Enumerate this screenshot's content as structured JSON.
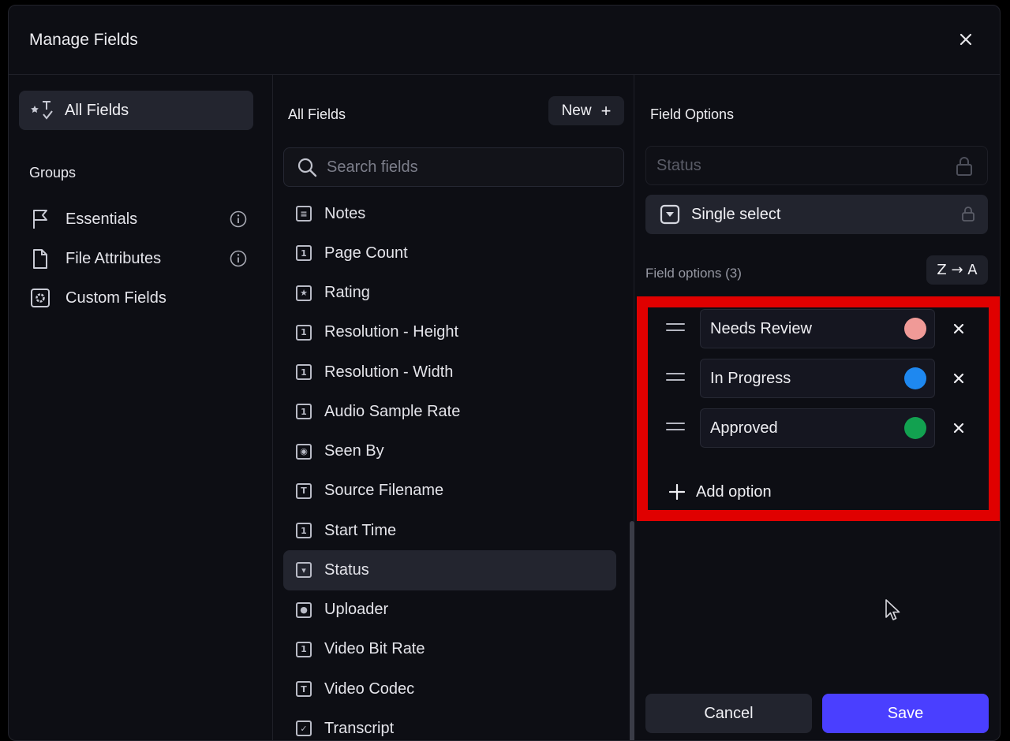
{
  "modal": {
    "title": "Manage Fields",
    "close_icon": "close-icon"
  },
  "left": {
    "all_fields_label": "All Fields",
    "groups_heading": "Groups",
    "groups": [
      {
        "label": "Essentials",
        "icon": "flag-icon"
      },
      {
        "label": "File Attributes",
        "icon": "file-icon"
      },
      {
        "label": "Custom Fields",
        "icon": "gear-box-icon"
      }
    ]
  },
  "middle": {
    "title": "All Fields",
    "new_label": "New",
    "search_placeholder": "Search fields",
    "fields": [
      {
        "label": "Notes",
        "glyph": "≡"
      },
      {
        "label": "Page Count",
        "glyph": "1"
      },
      {
        "label": "Rating",
        "glyph": "★"
      },
      {
        "label": "Resolution - Height",
        "glyph": "1"
      },
      {
        "label": "Resolution - Width",
        "glyph": "1"
      },
      {
        "label": "Audio Sample Rate",
        "glyph": "1"
      },
      {
        "label": "Seen By",
        "glyph": "◉"
      },
      {
        "label": "Source Filename",
        "glyph": "T"
      },
      {
        "label": "Start Time",
        "glyph": "1"
      },
      {
        "label": "Status",
        "glyph": "▾",
        "active": true
      },
      {
        "label": "Uploader",
        "glyph": "●"
      },
      {
        "label": "Video Bit Rate",
        "glyph": "1"
      },
      {
        "label": "Video Codec",
        "glyph": "T"
      },
      {
        "label": "Transcript",
        "glyph": "✓"
      }
    ]
  },
  "right": {
    "title": "Field Options",
    "name_value": "Status",
    "type_label": "Single select",
    "options_heading": "Field options (3)",
    "sort_label": "Z → A",
    "options": [
      {
        "label": "Needs Review",
        "color": "#f09a97"
      },
      {
        "label": "In Progress",
        "color": "#1e88f0"
      },
      {
        "label": "Approved",
        "color": "#12a150"
      }
    ],
    "add_option_label": "Add option",
    "cancel_label": "Cancel",
    "save_label": "Save"
  },
  "colors": {
    "accent": "#4a3fff",
    "highlight": "#e00000",
    "background": "#0d0e14"
  }
}
